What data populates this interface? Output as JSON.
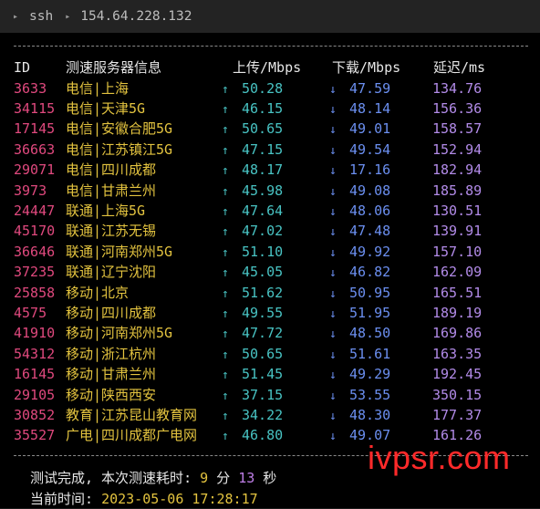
{
  "titlebar": {
    "crumbs": [
      "ssh",
      "154.64.228.132"
    ]
  },
  "table": {
    "headers": {
      "id": "ID",
      "node": "测速服务器信息",
      "upload": "上传/Mbps",
      "download": "下载/Mbps",
      "latency": "延迟/ms"
    },
    "up_arrow": "↑",
    "down_arrow": "↓",
    "rows": [
      {
        "id": "3633",
        "node": "电信|上海",
        "up": "50.28",
        "down": "47.59",
        "lat": "134.76"
      },
      {
        "id": "34115",
        "node": "电信|天津5G",
        "up": "46.15",
        "down": "48.14",
        "lat": "156.36"
      },
      {
        "id": "17145",
        "node": "电信|安徽合肥5G",
        "up": "50.65",
        "down": "49.01",
        "lat": "158.57"
      },
      {
        "id": "36663",
        "node": "电信|江苏镇江5G",
        "up": "47.15",
        "down": "49.54",
        "lat": "152.94"
      },
      {
        "id": "29071",
        "node": "电信|四川成都",
        "up": "48.17",
        "down": "17.16",
        "lat": "182.94"
      },
      {
        "id": "3973",
        "node": "电信|甘肃兰州",
        "up": "45.98",
        "down": "49.08",
        "lat": "185.89"
      },
      {
        "id": "24447",
        "node": "联通|上海5G",
        "up": "47.64",
        "down": "48.06",
        "lat": "130.51"
      },
      {
        "id": "45170",
        "node": "联通|江苏无锡",
        "up": "47.02",
        "down": "47.48",
        "lat": "139.91"
      },
      {
        "id": "36646",
        "node": "联通|河南郑州5G",
        "up": "51.10",
        "down": "49.92",
        "lat": "157.10"
      },
      {
        "id": "37235",
        "node": "联通|辽宁沈阳",
        "up": "45.05",
        "down": "46.82",
        "lat": "162.09"
      },
      {
        "id": "25858",
        "node": "移动|北京",
        "up": "51.62",
        "down": "50.95",
        "lat": "165.51"
      },
      {
        "id": "4575",
        "node": "移动|四川成都",
        "up": "49.55",
        "down": "51.95",
        "lat": "189.19"
      },
      {
        "id": "41910",
        "node": "移动|河南郑州5G",
        "up": "47.72",
        "down": "48.50",
        "lat": "169.86"
      },
      {
        "id": "54312",
        "node": "移动|浙江杭州",
        "up": "50.65",
        "down": "51.61",
        "lat": "163.35"
      },
      {
        "id": "16145",
        "node": "移动|甘肃兰州",
        "up": "51.45",
        "down": "49.29",
        "lat": "192.45"
      },
      {
        "id": "29105",
        "node": "移动|陕西西安",
        "up": "37.15",
        "down": "53.55",
        "lat": "350.15"
      },
      {
        "id": "30852",
        "node": "教育|江苏昆山教育网",
        "up": "34.22",
        "down": "48.30",
        "lat": "177.37"
      },
      {
        "id": "35527",
        "node": "广电|四川成都广电网",
        "up": "46.80",
        "down": "49.07",
        "lat": "161.26"
      }
    ]
  },
  "watermark": "ivpsr.com",
  "summary": {
    "prefix": "测试完成, 本次测速耗时: ",
    "minutes": "9",
    "min_unit": " 分 ",
    "seconds": "13",
    "sec_unit": " 秒"
  },
  "current_time": {
    "label": "当前时间: ",
    "value": "2023-05-06 17:28:17"
  },
  "colors": {
    "id": "#e0497e",
    "node": "#e3c33f",
    "upload": "#48c3c3",
    "download": "#6b8ff0",
    "latency": "#b28be8",
    "watermark": "#ff2a2a"
  }
}
